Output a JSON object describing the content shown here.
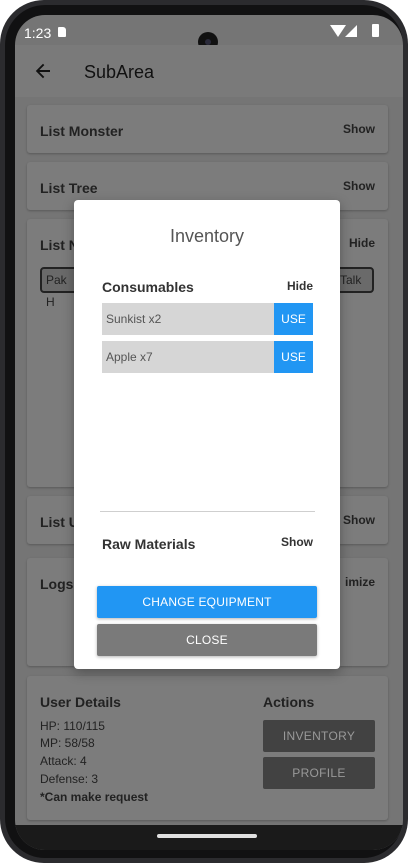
{
  "status_bar": {
    "time": "1:23",
    "icons": [
      "sd-card-icon",
      "wifi-icon",
      "signal-icon",
      "battery-icon"
    ]
  },
  "app_bar": {
    "title": "SubArea",
    "back_icon": "arrow-left-icon"
  },
  "background": {
    "list_monster": {
      "title": "List Monster",
      "action": "Show"
    },
    "list_tree": {
      "title": "List Tree",
      "action": "Show"
    },
    "list_npc": {
      "title": "List N",
      "action": "Hide",
      "chip_left": "Pak H",
      "chip_right": "Talk"
    },
    "list_user": {
      "title": "List U",
      "action": "Show"
    },
    "logs": {
      "title": "Logs",
      "action": "imize"
    },
    "user_details": {
      "title": "User Details",
      "hp": "HP: 110/115",
      "mp": "MP: 58/58",
      "attack": "Attack: 4",
      "defense": "Defense: 3",
      "note": "*Can make request"
    },
    "actions": {
      "title": "Actions",
      "inventory_label": "INVENTORY",
      "profile_label": "PROFILE"
    }
  },
  "dialog": {
    "title": "Inventory",
    "consumables": {
      "title": "Consumables",
      "action": "Hide",
      "items": [
        {
          "name": "Sunkist x2",
          "button": "USE"
        },
        {
          "name": "Apple x7",
          "button": "USE"
        }
      ]
    },
    "raw_materials": {
      "title": "Raw Materials",
      "action": "Show"
    },
    "change_equipment_label": "CHANGE EQUIPMENT",
    "close_label": "CLOSE"
  },
  "colors": {
    "accent": "#2196f3",
    "scrim_gray": "#757575",
    "close_button": "#7a7a7a",
    "item_row": "#d6d6d6"
  }
}
